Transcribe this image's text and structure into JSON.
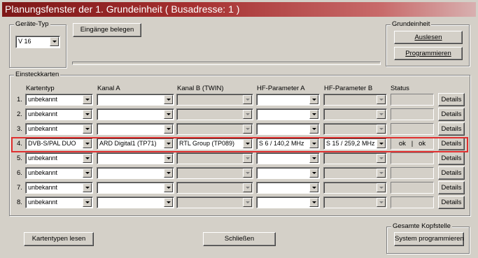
{
  "window": {
    "title": "Planungsfenster der 1. Grundeinheit ( Busadresse: 1 )"
  },
  "geraete_typ": {
    "legend": "Geräte-Typ",
    "selected": "V 16",
    "eingaenge_button": "Eingänge belegen"
  },
  "grundeinheit": {
    "legend": "Grundeinheit",
    "auslesen": "Auslesen",
    "programmieren": "Programmieren"
  },
  "einsteckkarten": {
    "legend": "Einsteckkarten",
    "headers": {
      "kartentyp": "Kartentyp",
      "kanal_a": "Kanal A",
      "kanal_b": "Kanal B (TWIN)",
      "hf_a": "HF-Parameter A",
      "hf_b": "HF-Parameter B",
      "status": "Status"
    },
    "rows": [
      {
        "num": "1.",
        "kartentyp": "unbekannt",
        "kanal_a": "",
        "kanal_b": "",
        "hf_a": "",
        "hf_b": "",
        "status": "",
        "details": "Details"
      },
      {
        "num": "2.",
        "kartentyp": "unbekannt",
        "kanal_a": "",
        "kanal_b": "",
        "hf_a": "",
        "hf_b": "",
        "status": "",
        "details": "Details"
      },
      {
        "num": "3.",
        "kartentyp": "unbekannt",
        "kanal_a": "",
        "kanal_b": "",
        "hf_a": "",
        "hf_b": "",
        "status": "",
        "details": "Details"
      },
      {
        "num": "4.",
        "kartentyp": "DVB-S/PAL DUO",
        "kanal_a": "ARD Digital1 (TP71)",
        "kanal_b": "RTL Group (TP089)",
        "hf_a": "S 6 / 140,2 MHz",
        "hf_b": "S 15 / 259,2 MHz",
        "status": "ok   |   ok",
        "details": "Details"
      },
      {
        "num": "5.",
        "kartentyp": "unbekannt",
        "kanal_a": "",
        "kanal_b": "",
        "hf_a": "",
        "hf_b": "",
        "status": "",
        "details": "Details"
      },
      {
        "num": "6.",
        "kartentyp": "unbekannt",
        "kanal_a": "",
        "kanal_b": "",
        "hf_a": "",
        "hf_b": "",
        "status": "",
        "details": "Details"
      },
      {
        "num": "7.",
        "kartentyp": "unbekannt",
        "kanal_a": "",
        "kanal_b": "",
        "hf_a": "",
        "hf_b": "",
        "status": "",
        "details": "Details"
      },
      {
        "num": "8.",
        "kartentyp": "unbekannt",
        "kanal_a": "",
        "kanal_b": "",
        "hf_a": "",
        "hf_b": "",
        "status": "",
        "details": "Details"
      }
    ]
  },
  "footer": {
    "kartentypen_lesen": "Kartentypen lesen",
    "schliessen": "Schließen",
    "kopfstelle_legend": "Gesamte Kopfstelle",
    "system_programmieren": "System programmieren"
  },
  "colors": {
    "highlight": "#e03030",
    "title_start": "#7d1818",
    "title_end": "#d8b0b0"
  }
}
